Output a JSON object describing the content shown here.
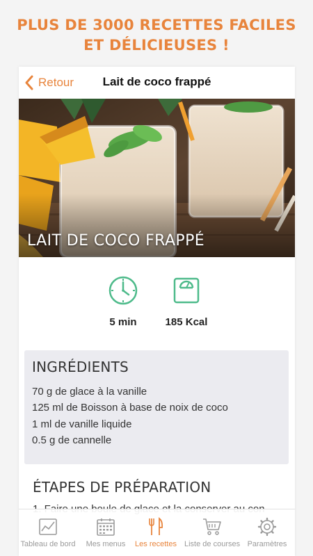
{
  "promo": {
    "line1": "PLUS DE 3000 RECETTES FACILES",
    "line2": "ET DÉLICIEUSES !"
  },
  "navbar": {
    "back_label": "Retour",
    "title": "Lait de coco frappé"
  },
  "hero": {
    "title": "LAIT DE COCO FRAPPÉ"
  },
  "stats": {
    "time": "5 min",
    "calories": "185 Kcal"
  },
  "ingredients": {
    "title": "INGRÉDIENTS",
    "items": [
      "70 g de glace à la vanille",
      "125 ml de Boisson à base de noix de coco",
      "1 ml de vanille liquide",
      "0.5 g de cannelle"
    ]
  },
  "steps": {
    "title": "ÉTAPES DE PRÉPARATION",
    "first": "1. Faire une boule de glace et la conserver au con"
  },
  "tabbar": {
    "items": [
      {
        "label": "Tableau de bord",
        "icon": "chart-icon"
      },
      {
        "label": "Mes menus",
        "icon": "calendar-icon"
      },
      {
        "label": "Les recettes",
        "icon": "utensils-icon",
        "active": true
      },
      {
        "label": "Liste de courses",
        "icon": "cart-icon"
      },
      {
        "label": "Paramètres",
        "icon": "gear-icon"
      }
    ]
  },
  "colors": {
    "accent": "#e8843c",
    "icon_green": "#4dba8a",
    "tab_inactive": "#9a9a9a",
    "ingredients_bg": "#ebebf0"
  }
}
